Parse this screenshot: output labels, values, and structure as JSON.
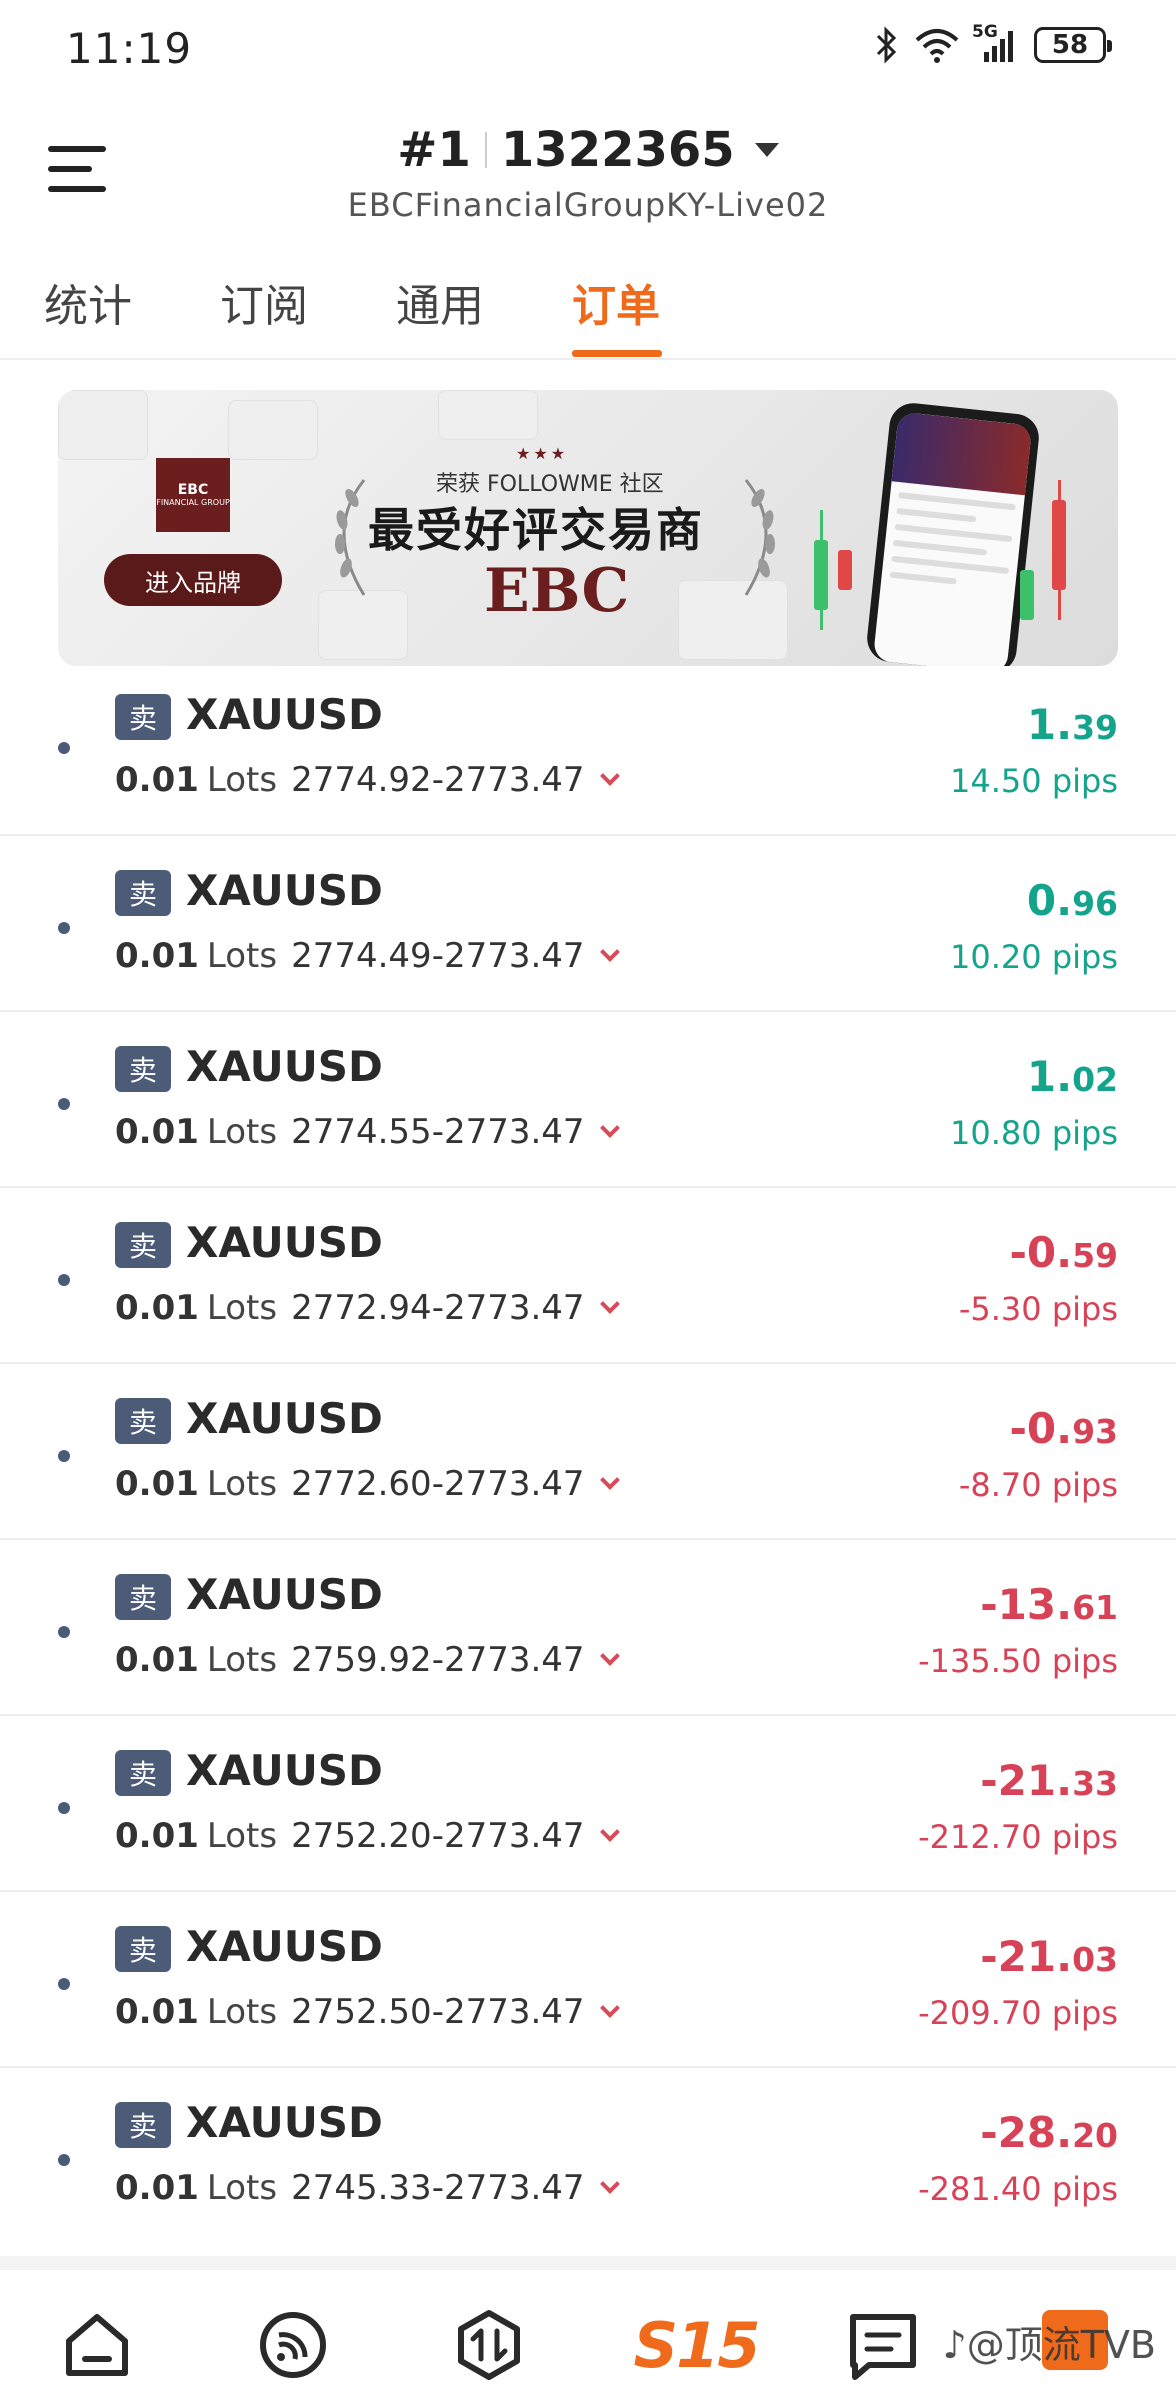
{
  "status_bar": {
    "time": "11:19",
    "battery": "58",
    "network": "5G"
  },
  "header": {
    "account_number": "#1",
    "account_id": "1322365",
    "server": "EBCFinancialGroupKY-Live02"
  },
  "tabs": [
    {
      "label": "统计",
      "active": false
    },
    {
      "label": "订阅",
      "active": false
    },
    {
      "label": "通用",
      "active": false
    },
    {
      "label": "订单",
      "active": true
    }
  ],
  "banner": {
    "award_prefix": "荣获 FOLLOWME 社区",
    "award_title": "最受好评交易商",
    "brand": "EBC",
    "enter_button": "进入品牌",
    "logo_text": "EBC",
    "logo_subtext": "FINANCIAL GROUP"
  },
  "orders": [
    {
      "side": "卖",
      "symbol": "XAUUSD",
      "lots": "0.01",
      "lots_label": "Lots",
      "range": "2774.92-2773.47",
      "profit_int": "1.",
      "profit_dec": "39",
      "pips": "14.50 pips",
      "positive": true
    },
    {
      "side": "卖",
      "symbol": "XAUUSD",
      "lots": "0.01",
      "lots_label": "Lots",
      "range": "2774.49-2773.47",
      "profit_int": "0.",
      "profit_dec": "96",
      "pips": "10.20 pips",
      "positive": true
    },
    {
      "side": "卖",
      "symbol": "XAUUSD",
      "lots": "0.01",
      "lots_label": "Lots",
      "range": "2774.55-2773.47",
      "profit_int": "1.",
      "profit_dec": "02",
      "pips": "10.80 pips",
      "positive": true
    },
    {
      "side": "卖",
      "symbol": "XAUUSD",
      "lots": "0.01",
      "lots_label": "Lots",
      "range": "2772.94-2773.47",
      "profit_int": "-0.",
      "profit_dec": "59",
      "pips": "-5.30 pips",
      "positive": false
    },
    {
      "side": "卖",
      "symbol": "XAUUSD",
      "lots": "0.01",
      "lots_label": "Lots",
      "range": "2772.60-2773.47",
      "profit_int": "-0.",
      "profit_dec": "93",
      "pips": "-8.70 pips",
      "positive": false
    },
    {
      "side": "卖",
      "symbol": "XAUUSD",
      "lots": "0.01",
      "lots_label": "Lots",
      "range": "2759.92-2773.47",
      "profit_int": "-13.",
      "profit_dec": "61",
      "pips": "-135.50 pips",
      "positive": false
    },
    {
      "side": "卖",
      "symbol": "XAUUSD",
      "lots": "0.01",
      "lots_label": "Lots",
      "range": "2752.20-2773.47",
      "profit_int": "-21.",
      "profit_dec": "33",
      "pips": "-212.70 pips",
      "positive": false
    },
    {
      "side": "卖",
      "symbol": "XAUUSD",
      "lots": "0.01",
      "lots_label": "Lots",
      "range": "2752.50-2773.47",
      "profit_int": "-21.",
      "profit_dec": "03",
      "pips": "-209.70 pips",
      "positive": false
    },
    {
      "side": "卖",
      "symbol": "XAUUSD",
      "lots": "0.01",
      "lots_label": "Lots",
      "range": "2745.33-2773.47",
      "profit_int": "-28.",
      "profit_dec": "20",
      "pips": "-281.40 pips",
      "positive": false
    }
  ],
  "bottom_nav": {
    "items": [
      "home-icon",
      "feed-icon",
      "trade-icon",
      "s15-icon",
      "message-icon"
    ],
    "s15_label": "S15",
    "watermark": "♪@顶流TVB"
  },
  "colors": {
    "accent": "#ef6a1a",
    "positive": "#14a38b",
    "negative": "#d74256",
    "badge": "#4c5b78"
  }
}
